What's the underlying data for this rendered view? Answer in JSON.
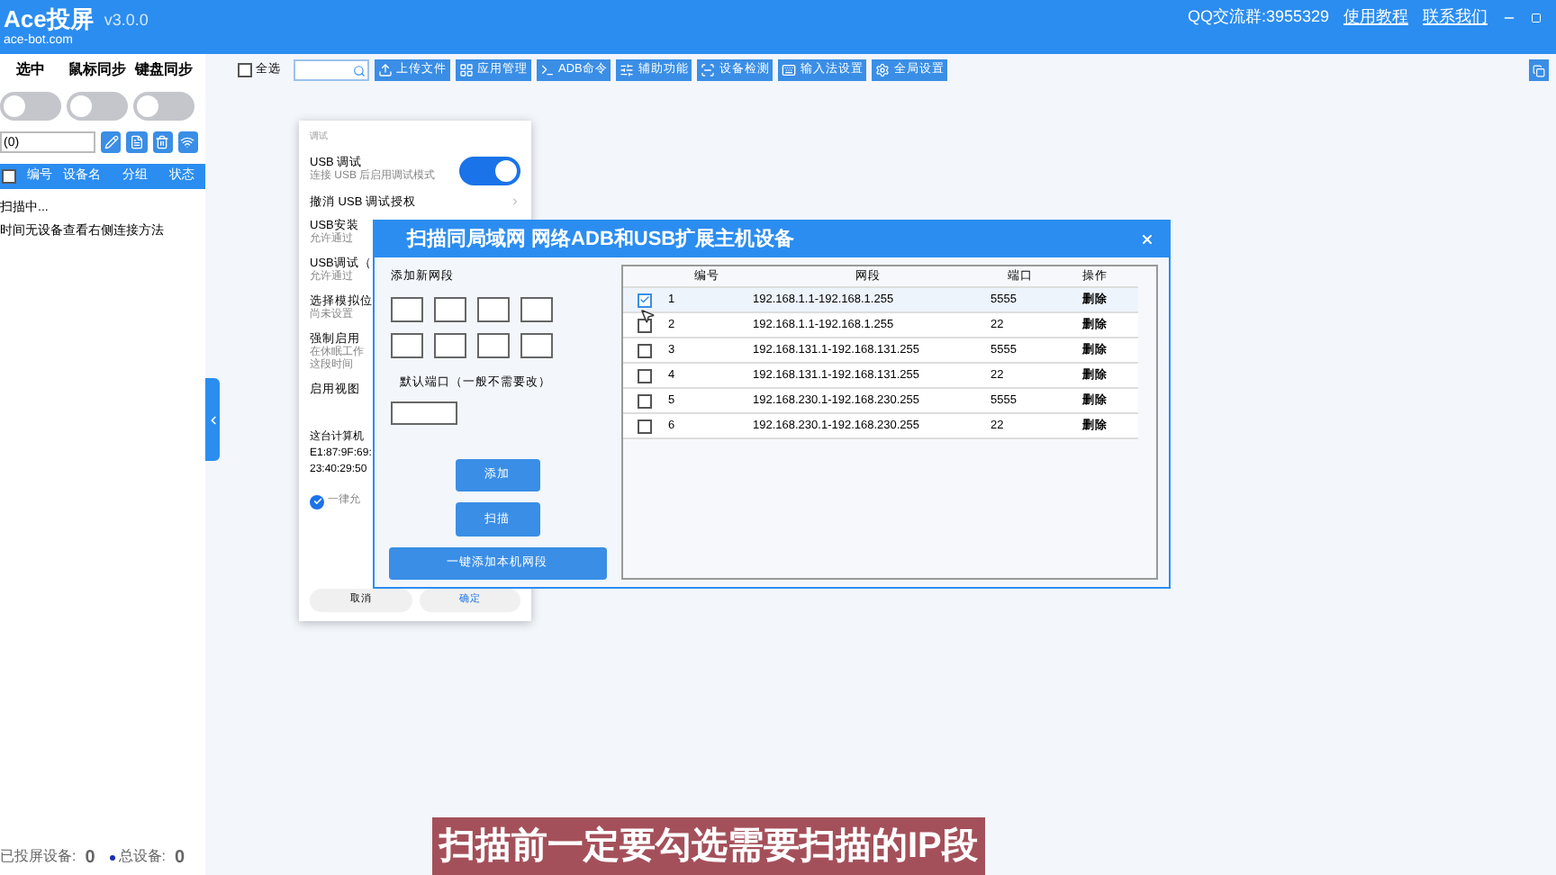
{
  "header": {
    "app_name": "Ace投屏",
    "site": "ace-bot.com",
    "version": "v3.0.0",
    "qq": "QQ交流群:3955329",
    "links": [
      "使用教程",
      "联系我们"
    ]
  },
  "left_panel": {
    "sync_toggles": [
      {
        "label": "选中",
        "on": false
      },
      {
        "label": "鼠标同步",
        "on": false
      },
      {
        "label": "键盘同步",
        "on": false
      }
    ],
    "device_field": {
      "value": "(0)"
    },
    "list_header": {
      "checked": false,
      "columns": [
        "编号",
        "设备名",
        "分组",
        "状态"
      ]
    },
    "messages": [
      "扫描中...",
      "时间无设备查看右侧连接方法"
    ],
    "footer": [
      {
        "label": "已投屏设备:",
        "value": "0",
        "kind": "plain"
      },
      {
        "label": "总设备:",
        "value": "0",
        "kind": "dot"
      }
    ]
  },
  "toolbar": {
    "select_all": {
      "label": "全选",
      "checked": false
    },
    "buttons": [
      "上传文件",
      "应用管理",
      "ADB命令",
      "辅助功能",
      "设备检测",
      "输入法设置",
      "全局设置"
    ]
  },
  "phone_settings": {
    "section": "调试",
    "items": [
      {
        "kind": "toggle",
        "title": "USB 调试",
        "subtitle": "连接 USB 后启用调试模式",
        "on": true
      },
      {
        "kind": "link",
        "title": "撤消 USB 调试授权"
      },
      {
        "kind": "text",
        "title": "USB安装",
        "subtitle": "允许通过"
      },
      {
        "kind": "text",
        "title": "USB调试（",
        "subtitle": "允许通过"
      },
      {
        "kind": "text",
        "title": "选择模拟位",
        "subtitle": "尚未设置"
      },
      {
        "kind": "text",
        "title": "强制启用",
        "subtitle": "在休眠工作",
        "subtitle2": "这段时间"
      },
      {
        "kind": "text",
        "title": "启用视图"
      }
    ],
    "auth_prompt": {
      "lines": [
        "这台计算机",
        "E1:87:9F:69:",
        "23:40:29:50"
      ],
      "checkbox": {
        "label": "一律允",
        "checked": true
      },
      "buttons": [
        "取消",
        "确定"
      ]
    }
  },
  "scan_dialog": {
    "title": "扫描同局域网 网络ADB和USB扩展主机设备",
    "add_label": "添加新网段",
    "port_label": "默认端口（一般不需要改）",
    "buttons": [
      "添加",
      "扫描"
    ],
    "wide_button": "一键添加本机网段",
    "table": {
      "columns": [
        "编号",
        "网段",
        "端口",
        "操作"
      ],
      "rows": [
        {
          "selected": true,
          "no": "1",
          "range": "192.168.1.1-192.168.1.255",
          "port": "5555",
          "action": "删除"
        },
        {
          "selected": false,
          "no": "2",
          "range": "192.168.1.1-192.168.1.255",
          "port": "22",
          "action": "删除"
        },
        {
          "selected": false,
          "no": "3",
          "range": "192.168.131.1-192.168.131.255",
          "port": "5555",
          "action": "删除"
        },
        {
          "selected": false,
          "no": "4",
          "range": "192.168.131.1-192.168.131.255",
          "port": "22",
          "action": "删除"
        },
        {
          "selected": false,
          "no": "5",
          "range": "192.168.230.1-192.168.230.255",
          "port": "5555",
          "action": "删除"
        },
        {
          "selected": false,
          "no": "6",
          "range": "192.168.230.1-192.168.230.255",
          "port": "22",
          "action": "删除"
        }
      ]
    }
  },
  "caption": "扫描前一定要勾选需要扫描的IP段"
}
